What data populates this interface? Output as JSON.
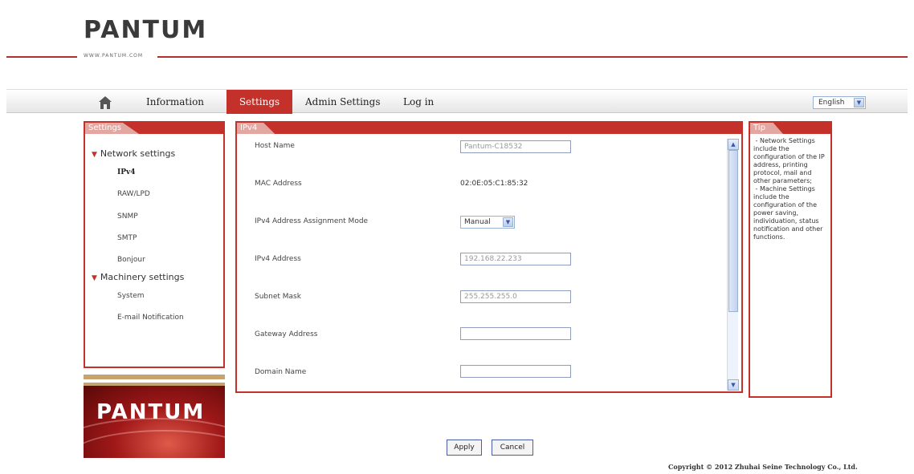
{
  "header": {
    "logo_text": "PANTUM",
    "logo_url_text": "WWW.PANTUM.COM"
  },
  "nav": {
    "home_icon": "home-icon",
    "items": [
      "Information",
      "Settings",
      "Admin Settings",
      "Log in"
    ],
    "active": "Settings",
    "language": "English"
  },
  "sidebar": {
    "title": "Settings",
    "groups": [
      {
        "label": "Network settings",
        "items": [
          "IPv4",
          "RAW/LPD",
          "SNMP",
          "SMTP",
          "Bonjour"
        ]
      },
      {
        "label": "Machinery settings",
        "items": [
          "System",
          "E-mail Notification"
        ]
      }
    ],
    "active_item": "IPv4",
    "brand_image_text": "PANTUM"
  },
  "main": {
    "title": "IPv4",
    "fields": [
      {
        "label": "Host Name",
        "type": "input",
        "value": "Pantum-C18532"
      },
      {
        "label": "MAC Address",
        "type": "text",
        "value": "02:0E:05:C1:85:32"
      },
      {
        "label": "IPv4 Address Assignment Mode",
        "type": "select",
        "value": "Manual"
      },
      {
        "label": "IPv4 Address",
        "type": "input",
        "value": "192.168.22.233"
      },
      {
        "label": "Subnet Mask",
        "type": "input",
        "value": "255.255.255.0"
      },
      {
        "label": "Gateway Address",
        "type": "input",
        "value": ""
      },
      {
        "label": "Domain Name",
        "type": "input",
        "value": ""
      }
    ]
  },
  "tip": {
    "title": "Tip",
    "text": " - Network Settings include the configuration of the IP address, printing protocol, mail and other parameters;\n - Machine Settings include the configuration of the power saving, individuation, status notification and other functions."
  },
  "buttons": {
    "apply": "Apply",
    "cancel": "Cancel"
  },
  "footer": {
    "copyright": "Copyright © 2012 Zhuhai Seine Technology Co., Ltd."
  },
  "colors": {
    "accent_red": "#c3312a",
    "brown_bar": "#c7a36d"
  }
}
